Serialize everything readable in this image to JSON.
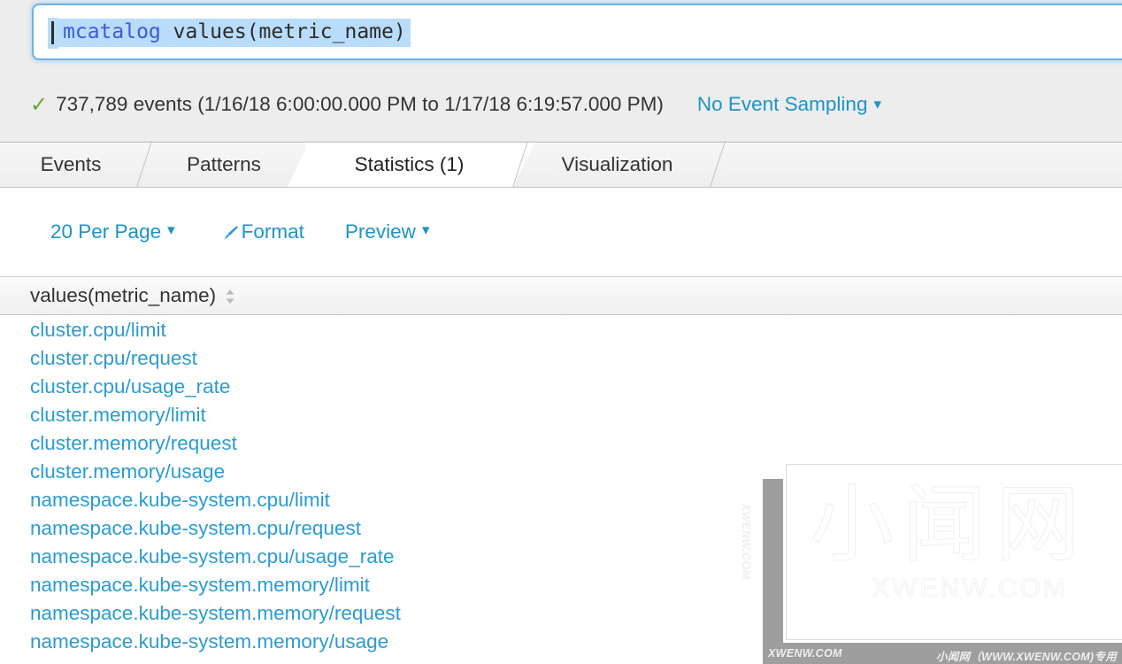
{
  "search": {
    "query_command": "mcatalog",
    "query_rest": " values(metric_name)",
    "full_query": "mcatalog values(metric_name)"
  },
  "events_bar": {
    "status_icon": "check-icon",
    "summary": "737,789 events (1/16/18 6:00:00.000 PM to 1/17/18 6:19:57.000 PM)",
    "sampling_label": "No Event Sampling",
    "sampling_chevron": "⌄"
  },
  "tabs": [
    {
      "label": "Events",
      "active": false
    },
    {
      "label": "Patterns",
      "active": false
    },
    {
      "label": "Statistics (1)",
      "active": true
    },
    {
      "label": "Visualization",
      "active": false
    }
  ],
  "results_toolbar": {
    "per_page_label": "20 Per Page",
    "per_page_chevron": "⌄",
    "format_label": "Format",
    "format_icon": "brush-icon",
    "preview_label": "Preview",
    "preview_chevron": "⌄"
  },
  "table": {
    "columns": [
      {
        "label": "values(metric_name)",
        "sort_icon": "sort-updown-icon"
      }
    ],
    "rows": [
      "cluster.cpu/limit",
      "cluster.cpu/request",
      "cluster.cpu/usage_rate",
      "cluster.memory/limit",
      "cluster.memory/request",
      "cluster.memory/usage",
      "namespace.kube-system.cpu/limit",
      "namespace.kube-system.cpu/request",
      "namespace.kube-system.cpu/usage_rate",
      "namespace.kube-system.memory/limit",
      "namespace.kube-system.memory/request",
      "namespace.kube-system.memory/usage"
    ]
  },
  "watermark": {
    "logo_text": "小闻网",
    "logo_sub": "XWENW.COM",
    "vertical_text": "XWENW.COM",
    "bottom_left": "XWENW.COM",
    "bottom_right": "小闻网（WWW.XWENW.COM)专用"
  },
  "colors": {
    "link_blue": "#2c9bd1",
    "accent_blue": "#1e93c6",
    "check_green": "#65a637",
    "chrome_gray": "#ededed",
    "selection_blue": "#b9dcfb",
    "focus_blue": "#6cb2e8"
  }
}
